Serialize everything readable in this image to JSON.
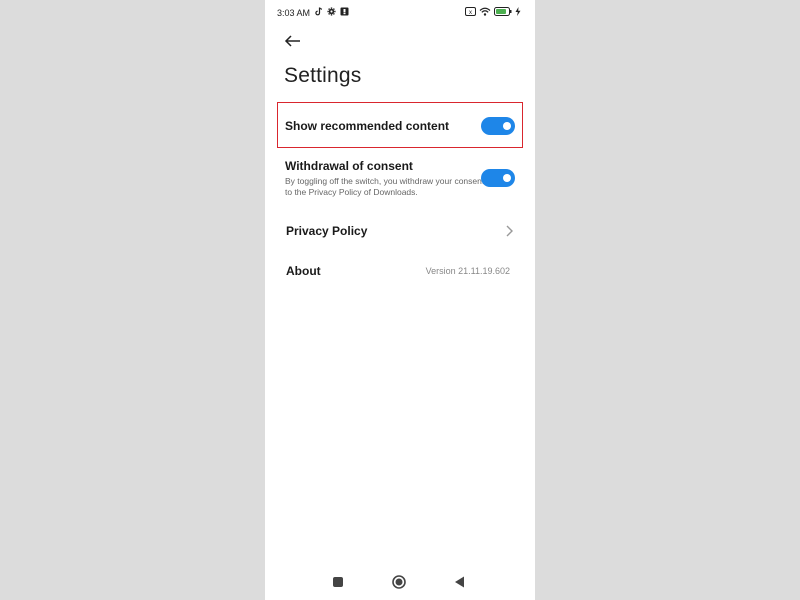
{
  "status_bar": {
    "time": "3:03 AM",
    "left_icons": [
      "tiktok-icon",
      "gear-icon",
      "notification-icon"
    ],
    "right_icons": [
      "sim-icon",
      "wifi-icon",
      "battery-icon",
      "charging-icon"
    ]
  },
  "header": {
    "back_icon": "arrow-left-icon",
    "title": "Settings"
  },
  "settings": {
    "show_recommended": {
      "label": "Show recommended content",
      "enabled": true
    },
    "withdrawal": {
      "label": "Withdrawal of consent",
      "description": "By toggling off the switch, you withdraw your consent to the Privacy Policy of Downloads.",
      "enabled": true
    },
    "privacy_policy": {
      "label": "Privacy Policy"
    },
    "about": {
      "label": "About",
      "version": "Version 21.11.19.602"
    }
  },
  "colors": {
    "toggle_on": "#1e86e8",
    "highlight": "#d9262e",
    "background": "#ffffff",
    "page_bg": "#dcdcdc"
  },
  "nav_bar": {
    "icons": [
      "recents-square-icon",
      "home-circle-icon",
      "back-triangle-icon"
    ]
  }
}
